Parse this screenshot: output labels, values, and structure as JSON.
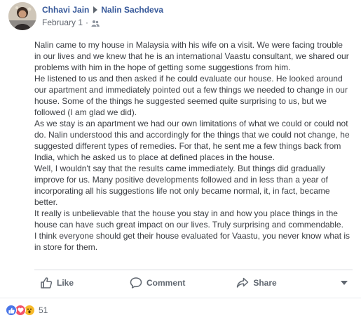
{
  "post": {
    "author": "Chhavi Jain",
    "recipient": "Nalin Sachdeva",
    "date": "February 1",
    "paragraphs": [
      "Nalin came to my house in Malaysia with his wife on a visit. We were facing trouble in our lives and we knew that he is an international Vaastu consultant, we shared our problems with him in the hope of getting some suggestions from him.",
      "He listened to us and then asked if he could evaluate our house. He looked around our apartment and immediately pointed out a few things we needed to change in our house. Some of the things he suggested seemed quite surprising to us, but we followed (I am glad we did).",
      "As we stay is an apartment we had our own limitations of what we could or could not do. Nalin understood this and accordingly for the things that we could not change, he suggested different types of remedies. For that, he sent me a few things back from India, which he asked us to place at defined places in the house.",
      "Well, I wouldn't say that the results came immediately. But things did gradually improve for us. Many positive developments followed and in less than a year of incorporating all his suggestions life not only became normal, it, in fact, became better.",
      "It really is unbelievable that the house you stay in and how you place things in the house can have such great impact on our lives. Truly surprising and commendable.",
      "I think everyone should get their house evaluated for Vaastu, you never know what is in store for them."
    ]
  },
  "actions": {
    "like_label": "Like",
    "comment_label": "Comment",
    "share_label": "Share"
  },
  "reactions": {
    "types": [
      "like",
      "love",
      "wow"
    ],
    "count": "51"
  },
  "colors": {
    "name_link": "#365899",
    "meta_text": "#616770",
    "body_text": "#3a3d42",
    "like_reaction": "#4a76e8",
    "love_reaction": "#f25268",
    "wow_reaction": "#f7b928"
  },
  "icons": {
    "separator": "triangle-right-icon",
    "audience": "friends-audience-icon",
    "like": "thumbs-up-icon",
    "comment": "speech-bubble-icon",
    "share": "share-arrow-icon",
    "menu": "chevron-down-icon"
  }
}
